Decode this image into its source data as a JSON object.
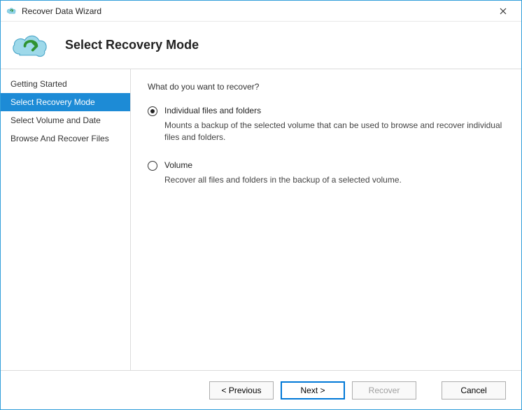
{
  "window": {
    "title": "Recover Data Wizard"
  },
  "header": {
    "title": "Select Recovery Mode"
  },
  "sidebar": {
    "items": [
      {
        "label": "Getting Started"
      },
      {
        "label": "Select Recovery Mode"
      },
      {
        "label": "Select Volume and Date"
      },
      {
        "label": "Browse And Recover Files"
      }
    ]
  },
  "content": {
    "prompt": "What do you want to recover?",
    "options": [
      {
        "label": "Individual files and folders",
        "desc": "Mounts a backup of the selected volume that can be used to browse and recover individual files and folders.",
        "selected": true
      },
      {
        "label": "Volume",
        "desc": "Recover all files and folders in the backup of a selected volume.",
        "selected": false
      }
    ]
  },
  "footer": {
    "previous": "< Previous",
    "next": "Next >",
    "recover": "Recover",
    "cancel": "Cancel"
  }
}
